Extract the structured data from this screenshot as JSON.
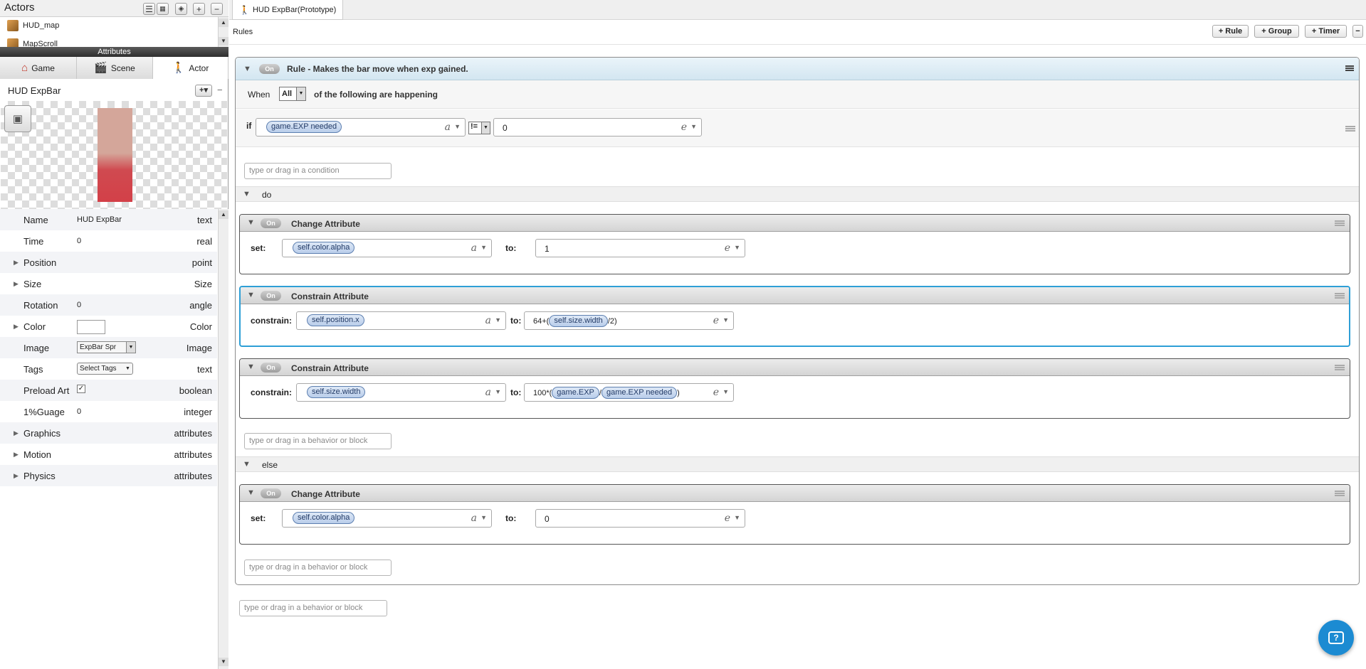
{
  "actors_panel": {
    "title": "Actors",
    "items": [
      "HUD_map",
      "MapScroll"
    ],
    "attributes_bar": "Attributes",
    "tabs": [
      {
        "label": "Game",
        "icon": "house-icon"
      },
      {
        "label": "Scene",
        "icon": "clapper-icon"
      },
      {
        "label": "Actor",
        "icon": "walking-person-icon"
      }
    ],
    "actor_name": "HUD ExpBar",
    "bar_color_top": "#d4a69a",
    "bar_color_bottom": "#d34048",
    "properties": [
      {
        "label": "Name",
        "value": "HUD ExpBar",
        "type": "text"
      },
      {
        "label": "Time",
        "value": "0",
        "type": "real"
      },
      {
        "label": "Position",
        "value": "",
        "type": "point"
      },
      {
        "label": "Size",
        "value": "",
        "type": "Size"
      },
      {
        "label": "Rotation",
        "value": "0",
        "type": "angle"
      },
      {
        "label": "Color",
        "value": "",
        "type": "Color"
      },
      {
        "label": "Image",
        "value": "ExpBar  Spr",
        "type": "Image"
      },
      {
        "label": "Tags",
        "value": "Select Tags",
        "type": "text"
      },
      {
        "label": "Preload Art",
        "value": "✓",
        "type": "boolean"
      },
      {
        "label": "1%Guage",
        "value": "0",
        "type": "integer"
      },
      {
        "label": "Graphics",
        "value": "",
        "type": "attributes"
      },
      {
        "label": "Motion",
        "value": "",
        "type": "attributes"
      },
      {
        "label": "Physics",
        "value": "",
        "type": "attributes"
      }
    ]
  },
  "editor": {
    "doc_tab": "HUD ExpBar(Prototype)",
    "rules_label": "Rules",
    "buttons": {
      "rule": "+ Rule",
      "group": "+ Group",
      "timer": "+ Timer",
      "minus": "−"
    },
    "rule": {
      "on": "On",
      "title": "Rule - Makes the bar move when exp gained.",
      "when_label": "When",
      "when_value": "All",
      "when_suffix": "of the following are happening",
      "if_label": "if",
      "condition": {
        "attribute": "game.EXP needed",
        "operator": "!=",
        "value": "0"
      },
      "condition_placeholder": "type or drag in a condition",
      "do_label": "do",
      "else_label": "else",
      "do_placeholder": "type or drag in a behavior or block",
      "else_placeholder": "type or drag in a behavior or block",
      "outer_placeholder": "type or drag in a behavior or block"
    },
    "behaviors": [
      {
        "on": "On",
        "title": "Change Attribute",
        "label": "set:",
        "attribute": "self.color.alpha",
        "to_label": "to:",
        "value": "1"
      },
      {
        "on": "On",
        "title": "Constrain Attribute",
        "label": "constrain:",
        "attribute": "self.position.x",
        "to_label": "to:",
        "expr_prefix": "64+(",
        "expr_tag": "self.size.width",
        "expr_suffix": "/2)"
      },
      {
        "on": "On",
        "title": "Constrain Attribute",
        "label": "constrain:",
        "attribute": "self.size.width",
        "to_label": "to:",
        "expr_prefix": "100*(",
        "expr_tag1": "game.EXP",
        "expr_mid": "/",
        "expr_tag2": "game.EXP needed",
        "expr_suffix": ")"
      },
      {
        "on": "On",
        "title": "Change Attribute",
        "label": "set:",
        "attribute": "self.color.alpha",
        "to_label": "to:",
        "value": "0"
      }
    ],
    "type_letters": {
      "attribute": "a",
      "expression": "e"
    }
  }
}
